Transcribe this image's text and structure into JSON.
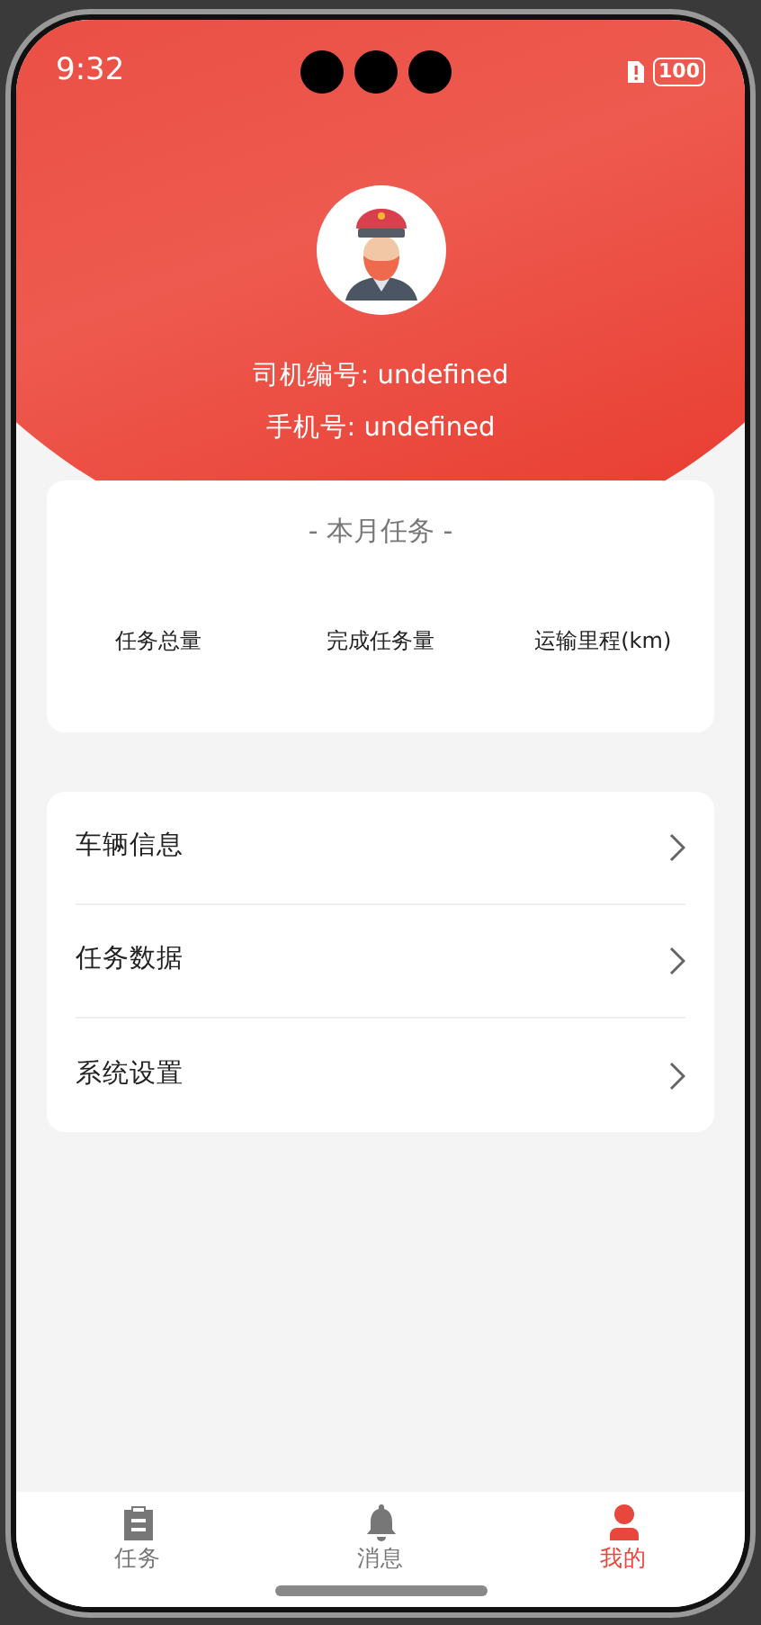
{
  "status_bar": {
    "time": "9:32",
    "battery": "100"
  },
  "profile": {
    "driver_id": "司机编号: undefined",
    "phone": "手机号: undefined"
  },
  "monthly_tasks": {
    "title": "- 本月任务 -",
    "stats": [
      {
        "label": "任务总量"
      },
      {
        "label": "完成任务量"
      },
      {
        "label": "运输里程(km)"
      }
    ]
  },
  "menu": [
    {
      "label": "车辆信息"
    },
    {
      "label": "任务数据"
    },
    {
      "label": "系统设置"
    }
  ],
  "tab_bar": [
    {
      "label": "任务",
      "kind": "clipboard",
      "selected": false
    },
    {
      "label": "消息",
      "kind": "bell",
      "selected": false
    },
    {
      "label": "我的",
      "kind": "person",
      "selected": true
    }
  ]
}
